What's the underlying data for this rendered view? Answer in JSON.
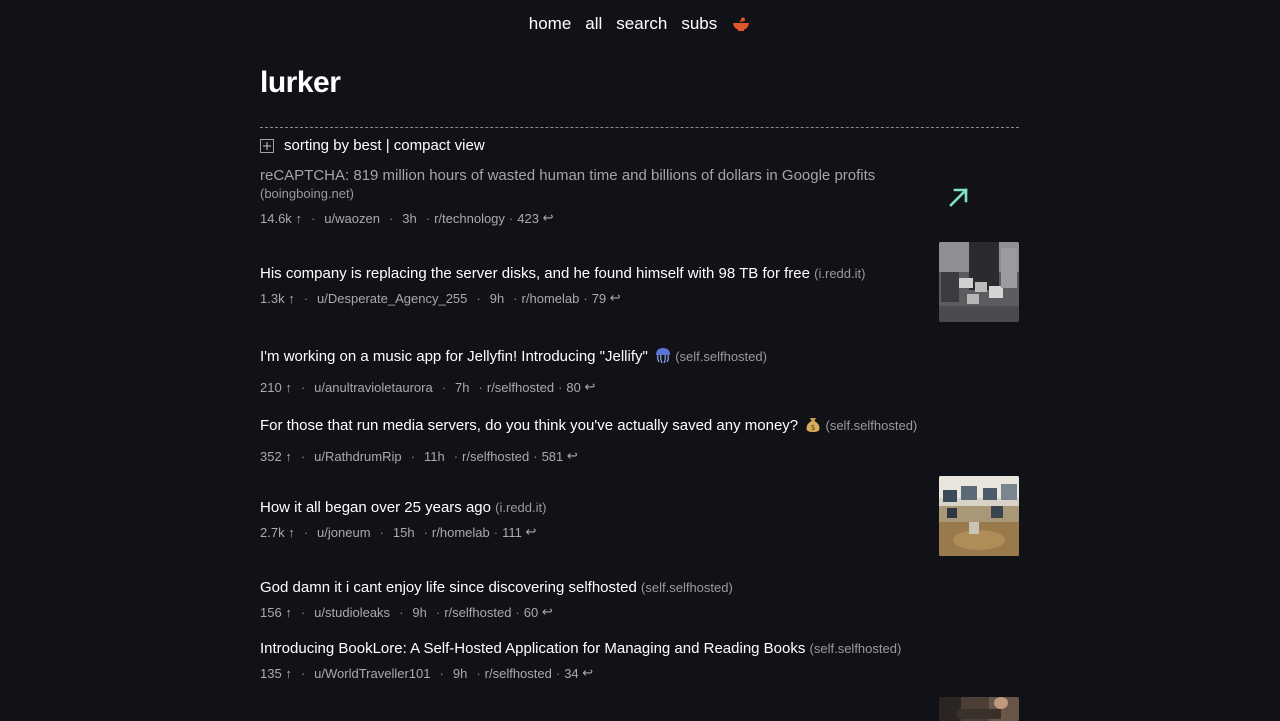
{
  "nav": {
    "items": [
      {
        "label": "home"
      },
      {
        "label": "all"
      },
      {
        "label": "search"
      },
      {
        "label": "subs"
      }
    ],
    "logo_icon": "bowl-icon"
  },
  "site": {
    "title": "lurker"
  },
  "sort": {
    "text": "sorting by best | compact view"
  },
  "posts": [
    {
      "title": "reCAPTCHA: 819 million hours of wasted human time and billions of dollars in Google profits",
      "domain": "(boingboing.net)",
      "score": "14.6k",
      "author": "u/waozen",
      "age": "3h",
      "sub": "r/technology",
      "comments": "423"
    },
    {
      "title": "His company is replacing the server disks, and he found himself with 98 TB for free",
      "domain": "(i.redd.it)",
      "score": "1.3k",
      "author": "u/Desperate_Agency_255",
      "age": "9h",
      "sub": "r/homelab",
      "comments": "79"
    },
    {
      "title": "I'm working on a music app for Jellyfin! Introducing \"Jellify\"",
      "domain": "(self.selfhosted)",
      "score": "210",
      "author": "u/anultravioletaurora",
      "age": "7h",
      "sub": "r/selfhosted",
      "comments": "80"
    },
    {
      "title": "For those that run media servers, do you think you've actually saved any money?",
      "domain": "(self.selfhosted)",
      "score": "352",
      "author": "u/RathdrumRip",
      "age": "11h",
      "sub": "r/selfhosted",
      "comments": "581"
    },
    {
      "title": "How it all began over 25 years ago",
      "domain": "(i.redd.it)",
      "score": "2.7k",
      "author": "u/joneum",
      "age": "15h",
      "sub": "r/homelab",
      "comments": "111"
    },
    {
      "title": "God damn it i cant enjoy life since discovering selfhosted",
      "domain": "(self.selfhosted)",
      "score": "156",
      "author": "u/studioleaks",
      "age": "9h",
      "sub": "r/selfhosted",
      "comments": "60"
    },
    {
      "title": "Introducing BookLore: A Self-Hosted Application for Managing and Reading Books",
      "domain": "(self.selfhosted)",
      "score": "135",
      "author": "u/WorldTraveller101",
      "age": "9h",
      "sub": "r/selfhosted",
      "comments": "34"
    }
  ],
  "glyphs": {
    "upvote": "↑",
    "reply": "↩",
    "dot": "·"
  },
  "colors": {
    "background": "#111217",
    "accent_arrow": "#7fe3c6",
    "logo": "#e0562b"
  }
}
